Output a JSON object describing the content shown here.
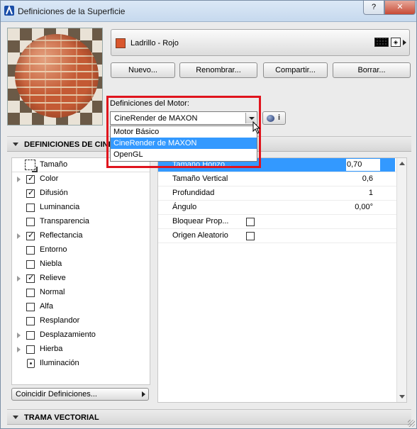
{
  "window": {
    "title": "Definiciones de la Superficie",
    "help": "?",
    "close": "✕"
  },
  "material": {
    "name": "Ladrillo - Rojo",
    "swatch_color": "#d9562d"
  },
  "buttons": {
    "new": "Nuevo...",
    "rename": "Renombrar...",
    "share": "Compartir...",
    "delete": "Borrar..."
  },
  "engine": {
    "label": "Definiciones del Motor:",
    "selected": "CineRender de MAXON",
    "info": "i",
    "options": [
      "Motor Básico",
      "CineRender de MAXON",
      "OpenGL"
    ]
  },
  "section1": {
    "title": "DEFINICIONES DE CINEMA"
  },
  "channels": {
    "header": "Tamaño",
    "items": [
      {
        "label": "Color",
        "checked": true,
        "expandable": true
      },
      {
        "label": "Difusión",
        "checked": true,
        "expandable": false
      },
      {
        "label": "Luminancia",
        "checked": false,
        "expandable": false
      },
      {
        "label": "Transparencia",
        "checked": false,
        "expandable": false
      },
      {
        "label": "Reflectancia",
        "checked": true,
        "expandable": true
      },
      {
        "label": "Entorno",
        "checked": false,
        "expandable": false
      },
      {
        "label": "Niebla",
        "checked": false,
        "expandable": false
      },
      {
        "label": "Relieve",
        "checked": true,
        "expandable": true
      },
      {
        "label": "Normal",
        "checked": false,
        "expandable": false
      },
      {
        "label": "Alfa",
        "checked": false,
        "expandable": false
      },
      {
        "label": "Resplandor",
        "checked": false,
        "expandable": false
      },
      {
        "label": "Desplazamiento",
        "checked": false,
        "expandable": true
      },
      {
        "label": "Hierba",
        "checked": false,
        "expandable": true
      }
    ],
    "lighting": "Iluminación"
  },
  "match_button": "Coincidir Definiciones...",
  "properties": {
    "selected": {
      "name": "Tamaño Horizo...",
      "value": "0,70"
    },
    "rows": [
      {
        "name": "Tamaño Vertical",
        "value": "0,6"
      },
      {
        "name": "Profundidad",
        "value": "1"
      },
      {
        "name": "Ángulo",
        "value": "0,00°"
      },
      {
        "name": "Bloquear Prop...",
        "checkbox": true
      },
      {
        "name": "Origen Aleatorio",
        "checkbox": true
      }
    ]
  },
  "section2": {
    "title": "TRAMA VECTORIAL"
  }
}
